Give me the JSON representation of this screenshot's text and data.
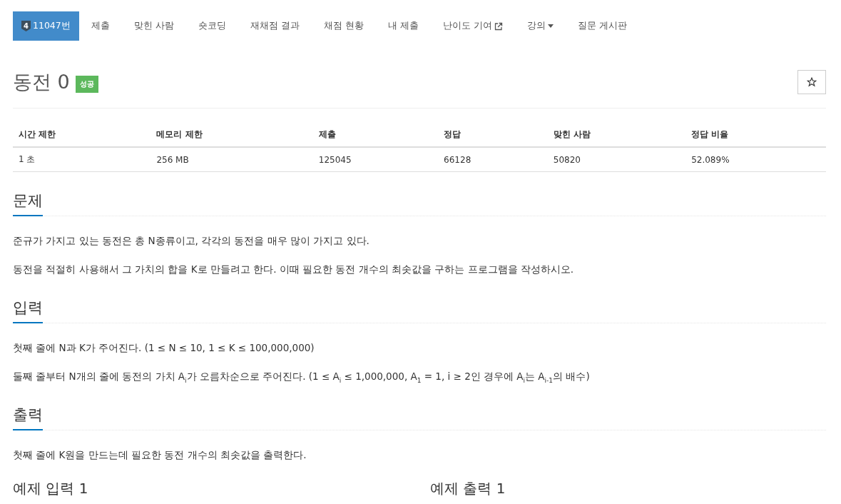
{
  "nav": {
    "items": [
      {
        "label": "11047번",
        "tier": "4",
        "selected": true,
        "kind": "problem"
      },
      {
        "label": "제출",
        "selected": false,
        "kind": "plain"
      },
      {
        "label": "맞힌 사람",
        "selected": false,
        "kind": "plain"
      },
      {
        "label": "숏코딩",
        "selected": false,
        "kind": "plain"
      },
      {
        "label": "재채점 결과",
        "selected": false,
        "kind": "plain"
      },
      {
        "label": "채점 현황",
        "selected": false,
        "kind": "plain"
      },
      {
        "label": "내 제출",
        "selected": false,
        "kind": "plain"
      },
      {
        "label": "난이도 기여",
        "selected": false,
        "kind": "external"
      },
      {
        "label": "강의",
        "selected": false,
        "kind": "dropdown"
      },
      {
        "label": "질문 게시판",
        "selected": false,
        "kind": "plain"
      }
    ]
  },
  "problem": {
    "title": "동전 0",
    "badge": "성공",
    "starred": false
  },
  "info_table": {
    "columns": [
      "시간 제한",
      "메모리 제한",
      "제출",
      "정답",
      "맞힌 사람",
      "정답 비율"
    ],
    "row": [
      "1 초",
      "256 MB",
      "125045",
      "66128",
      "50820",
      "52.089%"
    ]
  },
  "sections": [
    {
      "heading": "문제",
      "paragraphs": [
        "준규가 가지고 있는 동전은 총 N종류이고, 각각의 동전을 매우 많이 가지고 있다.",
        "동전을 적절히 사용해서 그 가치의 합을 K로 만들려고 한다. 이때 필요한 동전 개수의 최솟값을 구하는 프로그램을 작성하시오."
      ]
    },
    {
      "heading": "입력",
      "paragraphs": [
        "첫째 줄에 N과 K가 주어진다. (1 ≤ N ≤ 10, 1 ≤ K ≤ 100,000,000)",
        "둘째 줄부터 N개의 줄에 동전의 가치 A$_{i}$가 오름차순으로 주어진다. (1 ≤ A$_{i}$ ≤ 1,000,000, A$_{1}$ = 1, i ≥ 2인 경우에 A$_{i}$는 A$_{i-1}$의 배수)"
      ]
    },
    {
      "heading": "출력",
      "paragraphs": [
        "첫째 줄에 K원을 만드는데 필요한 동전 개수의 최솟값을 출력한다."
      ]
    }
  ],
  "samples": [
    "예제 입력 1",
    "예제 출력 1"
  ]
}
